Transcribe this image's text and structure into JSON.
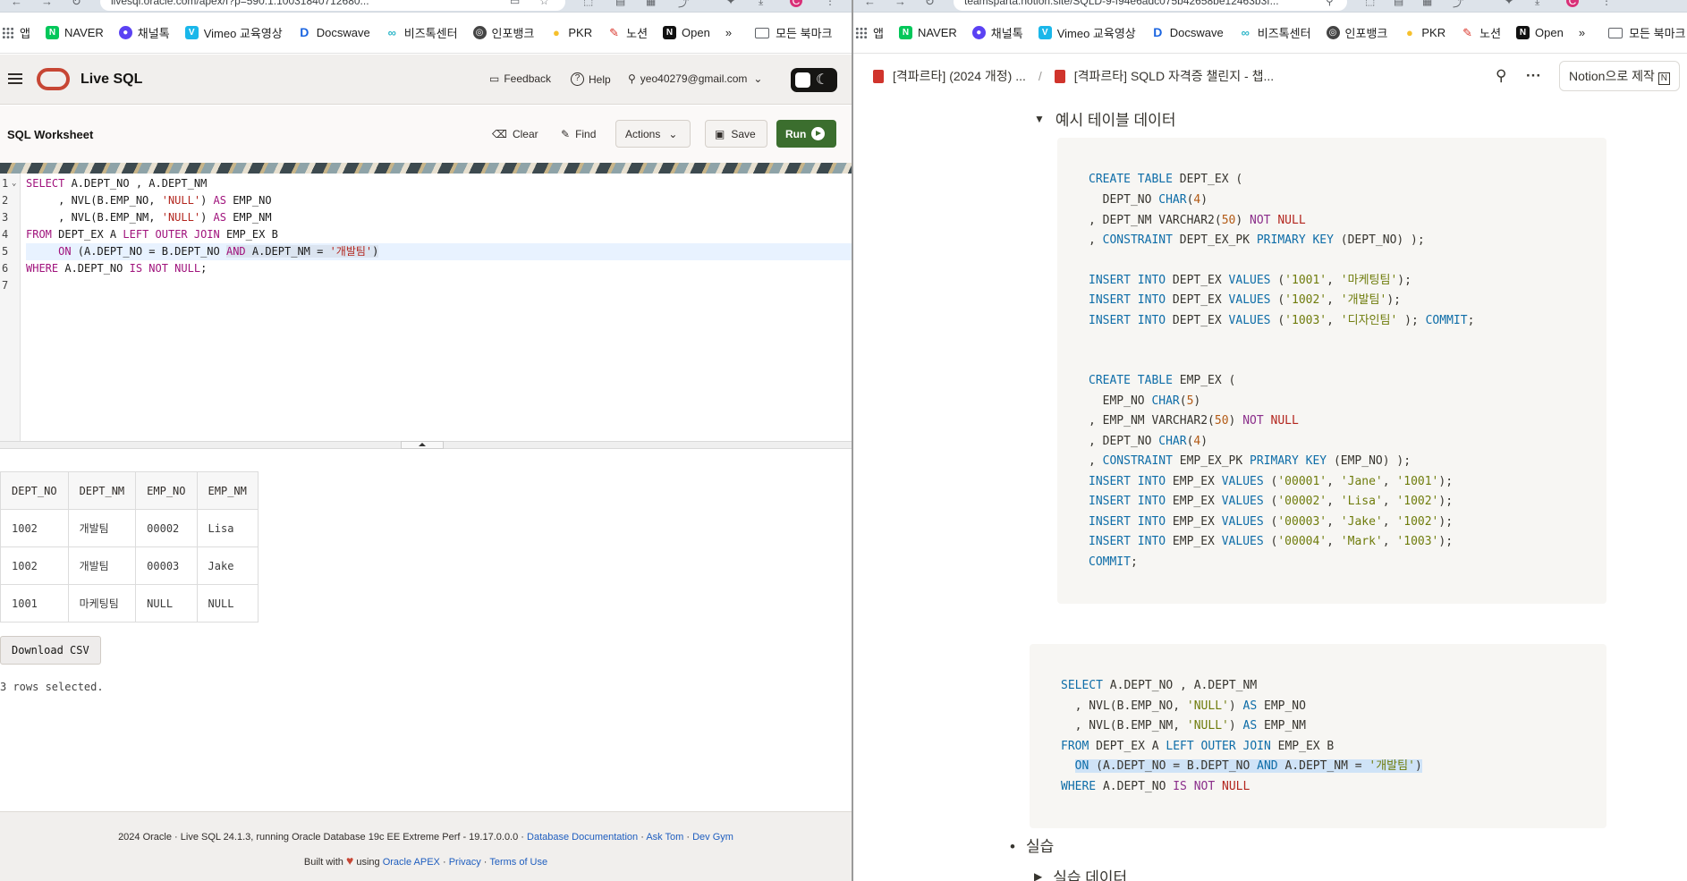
{
  "left": {
    "topbar": {
      "url": "livesql.oracle.com/apex/f?p=590:1:10031840712680..."
    },
    "bookmarks": [
      {
        "label": "앱",
        "icon": "grid-icon",
        "color": "#5f6368"
      },
      {
        "label": "NAVER",
        "icon": "naver-icon",
        "color": "#03c75a"
      },
      {
        "label": "채널톡",
        "icon": "channeltalk-icon",
        "color": "#5b42f3"
      },
      {
        "label": "Vimeo 교육영상",
        "icon": "vimeo-icon",
        "color": "#1ab7ea"
      },
      {
        "label": "Docswave",
        "icon": "docswave-icon",
        "color": "#1a64e0"
      },
      {
        "label": "비즈톡센터",
        "icon": "bizalk-icon",
        "color": "#2cb5c8"
      },
      {
        "label": "인포뱅크",
        "icon": "globe-icon",
        "color": "#444444"
      },
      {
        "label": "PKR",
        "icon": "bulb-icon",
        "color": "#f6c02c"
      },
      {
        "label": "노션",
        "icon": "pin-icon",
        "color": "#d93025"
      },
      {
        "label": "Open",
        "icon": "notion-icon",
        "color": "#111111"
      }
    ],
    "more_label": "»",
    "all_bookmarks": "모든 북마크",
    "app": {
      "title": "Live SQL",
      "feedback": "Feedback",
      "help": "Help",
      "user": "yeo40279@gmail.com"
    },
    "worksheet": {
      "title": "SQL Worksheet",
      "clear": "Clear",
      "find": "Find",
      "actions": "Actions",
      "save": "Save",
      "run": "Run"
    },
    "editor_lines": [
      "1",
      "2",
      "3",
      "4",
      "5",
      "6",
      "7"
    ],
    "results": {
      "columns": [
        "DEPT_NO",
        "DEPT_NM",
        "EMP_NO",
        "EMP_NM"
      ],
      "rows": [
        [
          "1002",
          "개발팀",
          "00002",
          "Lisa"
        ],
        [
          "1002",
          "개발팀",
          "00003",
          "Jake"
        ],
        [
          "1001",
          "마케팅팀",
          "NULL",
          "NULL"
        ]
      ],
      "download": "Download CSV",
      "status": "3 rows selected."
    },
    "footer": {
      "line1": "2024 Oracle · Live SQL 24.1.3, running Oracle Database 19c EE Extreme Perf - 19.17.0.0.0 ·",
      "docs": "Database Documentation",
      "asktom": "Ask Tom",
      "devgym": "Dev Gym",
      "built": "Built with",
      "using": "using",
      "apex": "Oracle APEX",
      "privacy": "Privacy",
      "terms": "Terms of Use"
    }
  },
  "right": {
    "topbar": {
      "url": "teamsparta.notion.site/SQLD-9-f94e6adc075b42658be12463b3f..."
    },
    "bookmarks": [
      {
        "label": "앱",
        "icon": "grid-icon",
        "color": "#5f6368"
      },
      {
        "label": "NAVER",
        "icon": "naver-icon",
        "color": "#03c75a"
      },
      {
        "label": "채널톡",
        "icon": "channeltalk-icon",
        "color": "#5b42f3"
      },
      {
        "label": "Vimeo 교육영상",
        "icon": "vimeo-icon",
        "color": "#1ab7ea"
      },
      {
        "label": "Docswave",
        "icon": "docswave-icon",
        "color": "#1a64e0"
      },
      {
        "label": "비즈톡센터",
        "icon": "bizalk-icon",
        "color": "#2cb5c8"
      },
      {
        "label": "인포뱅크",
        "icon": "globe-icon",
        "color": "#444444"
      },
      {
        "label": "PKR",
        "icon": "bulb-icon",
        "color": "#f6c02c"
      },
      {
        "label": "노션",
        "icon": "pin-icon",
        "color": "#d93025"
      },
      {
        "label": "Open",
        "icon": "notion-icon",
        "color": "#111111"
      }
    ],
    "more_label": "»",
    "all_bookmarks": "모든 북마크",
    "breadcrumb": [
      "[격파르타] (2024 개정) ...",
      "[격파르타] SQLD 자격증 챌린지 - 챕..."
    ],
    "breadcrumb_sep": "/",
    "made_with": "Notion으로 제작",
    "toggle_title": "예시 테이블 데이터",
    "bullet": "실습",
    "sub_toggle": "실습 데이터"
  }
}
